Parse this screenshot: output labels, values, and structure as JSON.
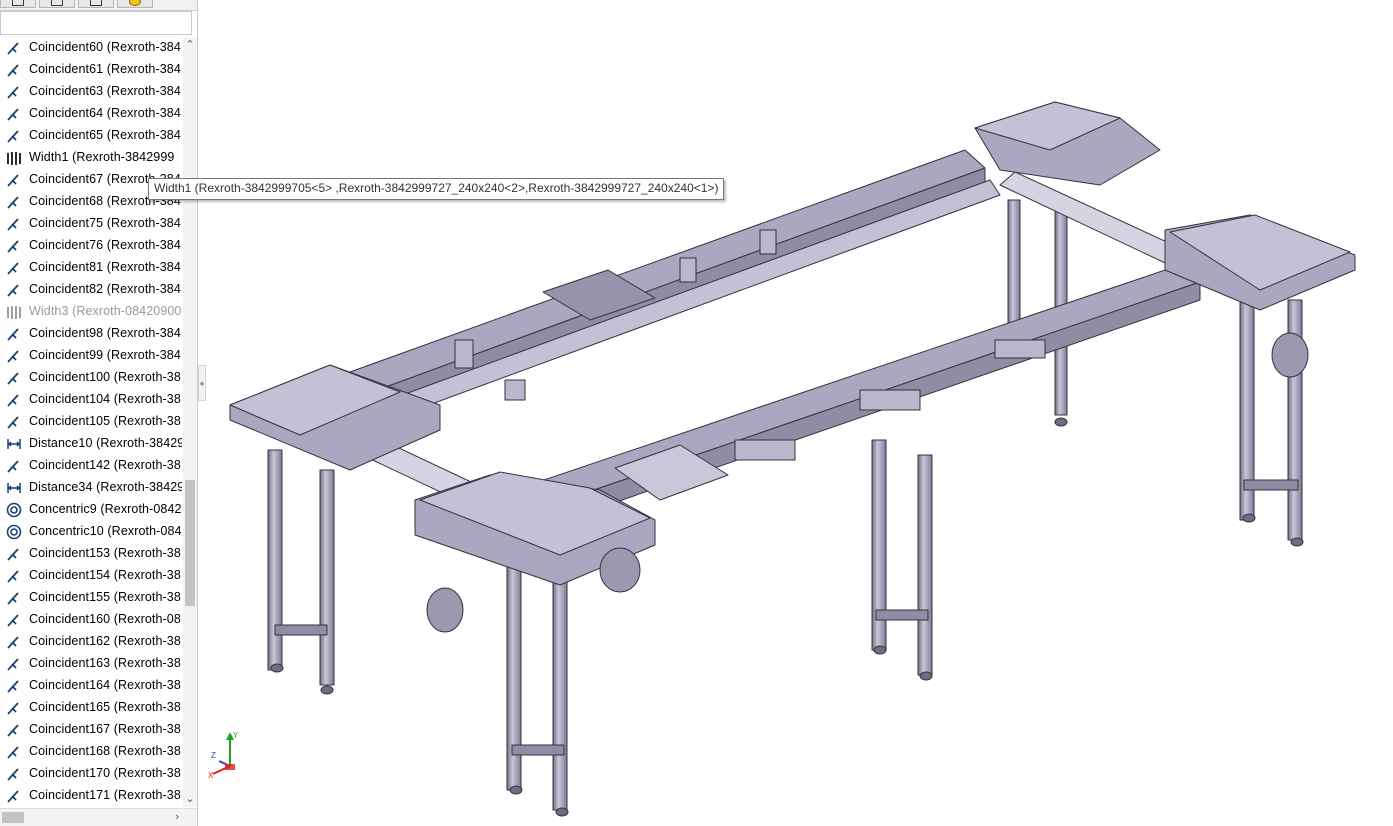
{
  "tabs": [
    {
      "name": "feature-manager-tab",
      "icon": "tree-icon"
    },
    {
      "name": "property-manager-tab",
      "icon": "property-icon"
    },
    {
      "name": "configuration-manager-tab",
      "icon": "config-icon"
    },
    {
      "name": "display-manager-tab",
      "icon": "appearance-icon"
    }
  ],
  "mates": [
    {
      "type": "coincident",
      "label": "Coincident60 (Rexroth-384"
    },
    {
      "type": "coincident",
      "label": "Coincident61 (Rexroth-384"
    },
    {
      "type": "coincident",
      "label": "Coincident63 (Rexroth-384"
    },
    {
      "type": "coincident",
      "label": "Coincident64 (Rexroth-384"
    },
    {
      "type": "coincident",
      "label": "Coincident65 (Rexroth-384"
    },
    {
      "type": "width",
      "label": "Width1 (Rexroth-3842999"
    },
    {
      "type": "coincident",
      "label": "Coincident67 (Rexroth-384"
    },
    {
      "type": "coincident",
      "label": "Coincident68 (Rexroth-384"
    },
    {
      "type": "coincident",
      "label": "Coincident75 (Rexroth-384"
    },
    {
      "type": "coincident",
      "label": "Coincident76 (Rexroth-384"
    },
    {
      "type": "coincident",
      "label": "Coincident81 (Rexroth-384"
    },
    {
      "type": "coincident",
      "label": "Coincident82 (Rexroth-384"
    },
    {
      "type": "width",
      "label": "Width3 (Rexroth-08420900",
      "suppressed": true
    },
    {
      "type": "coincident",
      "label": "Coincident98 (Rexroth-384"
    },
    {
      "type": "coincident",
      "label": "Coincident99 (Rexroth-384"
    },
    {
      "type": "coincident",
      "label": "Coincident100 (Rexroth-38"
    },
    {
      "type": "coincident",
      "label": "Coincident104 (Rexroth-38"
    },
    {
      "type": "coincident",
      "label": "Coincident105 (Rexroth-38"
    },
    {
      "type": "distance",
      "label": "Distance10 (Rexroth-38429"
    },
    {
      "type": "coincident",
      "label": "Coincident142 (Rexroth-38"
    },
    {
      "type": "distance",
      "label": "Distance34 (Rexroth-38429"
    },
    {
      "type": "concentric",
      "label": "Concentric9 (Rexroth-0842"
    },
    {
      "type": "concentric",
      "label": "Concentric10 (Rexroth-084"
    },
    {
      "type": "coincident",
      "label": "Coincident153 (Rexroth-38"
    },
    {
      "type": "coincident",
      "label": "Coincident154 (Rexroth-38"
    },
    {
      "type": "coincident",
      "label": "Coincident155 (Rexroth-38"
    },
    {
      "type": "coincident",
      "label": "Coincident160 (Rexroth-08"
    },
    {
      "type": "coincident",
      "label": "Coincident162 (Rexroth-38"
    },
    {
      "type": "coincident",
      "label": "Coincident163 (Rexroth-38"
    },
    {
      "type": "coincident",
      "label": "Coincident164 (Rexroth-38"
    },
    {
      "type": "coincident",
      "label": "Coincident165 (Rexroth-38"
    },
    {
      "type": "coincident",
      "label": "Coincident167 (Rexroth-38"
    },
    {
      "type": "coincident",
      "label": "Coincident168 (Rexroth-38"
    },
    {
      "type": "coincident",
      "label": "Coincident170 (Rexroth-38"
    },
    {
      "type": "coincident",
      "label": "Coincident171 (Rexroth-38"
    }
  ],
  "tooltip": {
    "text": "Width1 (Rexroth-3842999705<5> ,Rexroth-3842999727_240x240<2>,Rexroth-3842999727_240x240<1>)"
  },
  "triad": {
    "z_label": "Z",
    "y_label": "Y",
    "x_label": "X"
  },
  "colors": {
    "part_fill": "#a9a8c0",
    "part_top": "#c2c1d6",
    "edge": "#33333f",
    "leg": "#8e8da3",
    "x_axis": "#e21d1d",
    "y_axis": "#1fa51f",
    "z_axis": "#2646d6"
  }
}
